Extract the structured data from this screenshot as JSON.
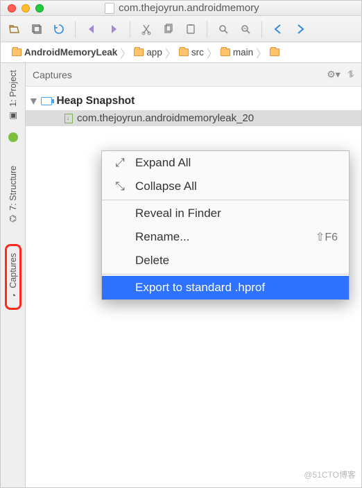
{
  "window": {
    "title": "com.thejoyrun.androidmemory"
  },
  "breadcrumb": [
    "AndroidMemoryLeak",
    "app",
    "src",
    "main"
  ],
  "captures": {
    "title": "Captures",
    "root": "Heap Snapshot",
    "file": "com.thejoyrun.androidmemoryleak_20"
  },
  "rail": {
    "project": "1: Project",
    "structure": "7: Structure",
    "captures": "Captures"
  },
  "menu": {
    "expand": "Expand All",
    "collapse": "Collapse All",
    "reveal": "Reveal in Finder",
    "rename": "Rename...",
    "rename_sc": "⇧F6",
    "delete": "Delete",
    "export": "Export to standard .hprof"
  },
  "watermark": "@51CTO博客"
}
